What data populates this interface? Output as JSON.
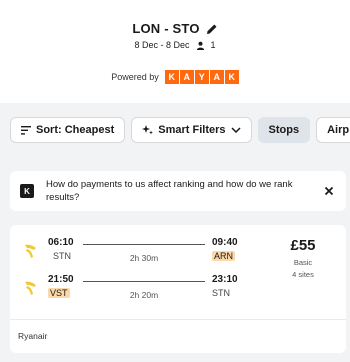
{
  "header": {
    "route": "LON - STO",
    "dates": "8 Dec - 8 Dec",
    "travellers": "1",
    "powered_by": "Powered by",
    "brand_letters": [
      "K",
      "A",
      "Y",
      "A",
      "K"
    ]
  },
  "filters": {
    "sort_label": "Sort: Cheapest",
    "smart_filters_label": "Smart Filters",
    "stops_label": "Stops",
    "airlines_label": "Airp"
  },
  "info": {
    "badge": "K",
    "text": "How do payments to us affect ranking and how do we rank results?"
  },
  "result": {
    "outbound": {
      "dep_time": "06:10",
      "dep_code": "STN",
      "duration": "2h 30m",
      "arr_time": "09:40",
      "arr_code": "ARN"
    },
    "inbound": {
      "dep_time": "21:50",
      "dep_code": "VST",
      "duration": "2h 20m",
      "arr_time": "23:10",
      "arr_code": "STN"
    },
    "price": "£55",
    "fare": "Basic",
    "sites": "4 sites",
    "airline": "Ryanair"
  },
  "colors": {
    "kayak_orange": "#ff690f",
    "highlight": "#fcd7a8",
    "ryanair_yellow": "#f1c933"
  }
}
